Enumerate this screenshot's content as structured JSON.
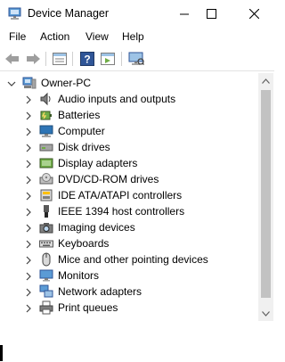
{
  "window": {
    "title": "Device Manager",
    "controls": {
      "minimize": "minimize",
      "maximize": "maximize",
      "close": "close"
    }
  },
  "menu": [
    "File",
    "Action",
    "View",
    "Help"
  ],
  "toolbar": [
    {
      "name": "back",
      "icon": "back-arrow-icon"
    },
    {
      "name": "forward",
      "icon": "forward-arrow-icon"
    },
    {
      "name": "properties",
      "icon": "properties-icon"
    },
    {
      "name": "help",
      "icon": "help-icon"
    },
    {
      "name": "show-hidden",
      "icon": "show-hidden-icon"
    },
    {
      "name": "scan-hardware",
      "icon": "monitor-scan-icon"
    }
  ],
  "tree": {
    "root": {
      "label": "Owner-PC",
      "icon": "computer-icon",
      "expanded": true
    },
    "categories": [
      {
        "label": "Audio inputs and outputs",
        "icon": "speaker-icon"
      },
      {
        "label": "Batteries",
        "icon": "battery-icon"
      },
      {
        "label": "Computer",
        "icon": "computer-icon"
      },
      {
        "label": "Disk drives",
        "icon": "disk-icon"
      },
      {
        "label": "Display adapters",
        "icon": "display-icon"
      },
      {
        "label": "DVD/CD-ROM drives",
        "icon": "dvd-icon"
      },
      {
        "label": "IDE ATA/ATAPI controllers",
        "icon": "ide-icon"
      },
      {
        "label": "IEEE 1394 host controllers",
        "icon": "firewire-icon"
      },
      {
        "label": "Imaging devices",
        "icon": "camera-icon"
      },
      {
        "label": "Keyboards",
        "icon": "keyboard-icon"
      },
      {
        "label": "Mice and other pointing devices",
        "icon": "mouse-icon"
      },
      {
        "label": "Monitors",
        "icon": "monitor-icon"
      },
      {
        "label": "Network adapters",
        "icon": "network-icon"
      },
      {
        "label": "Print queues",
        "icon": "printer-icon"
      }
    ]
  }
}
